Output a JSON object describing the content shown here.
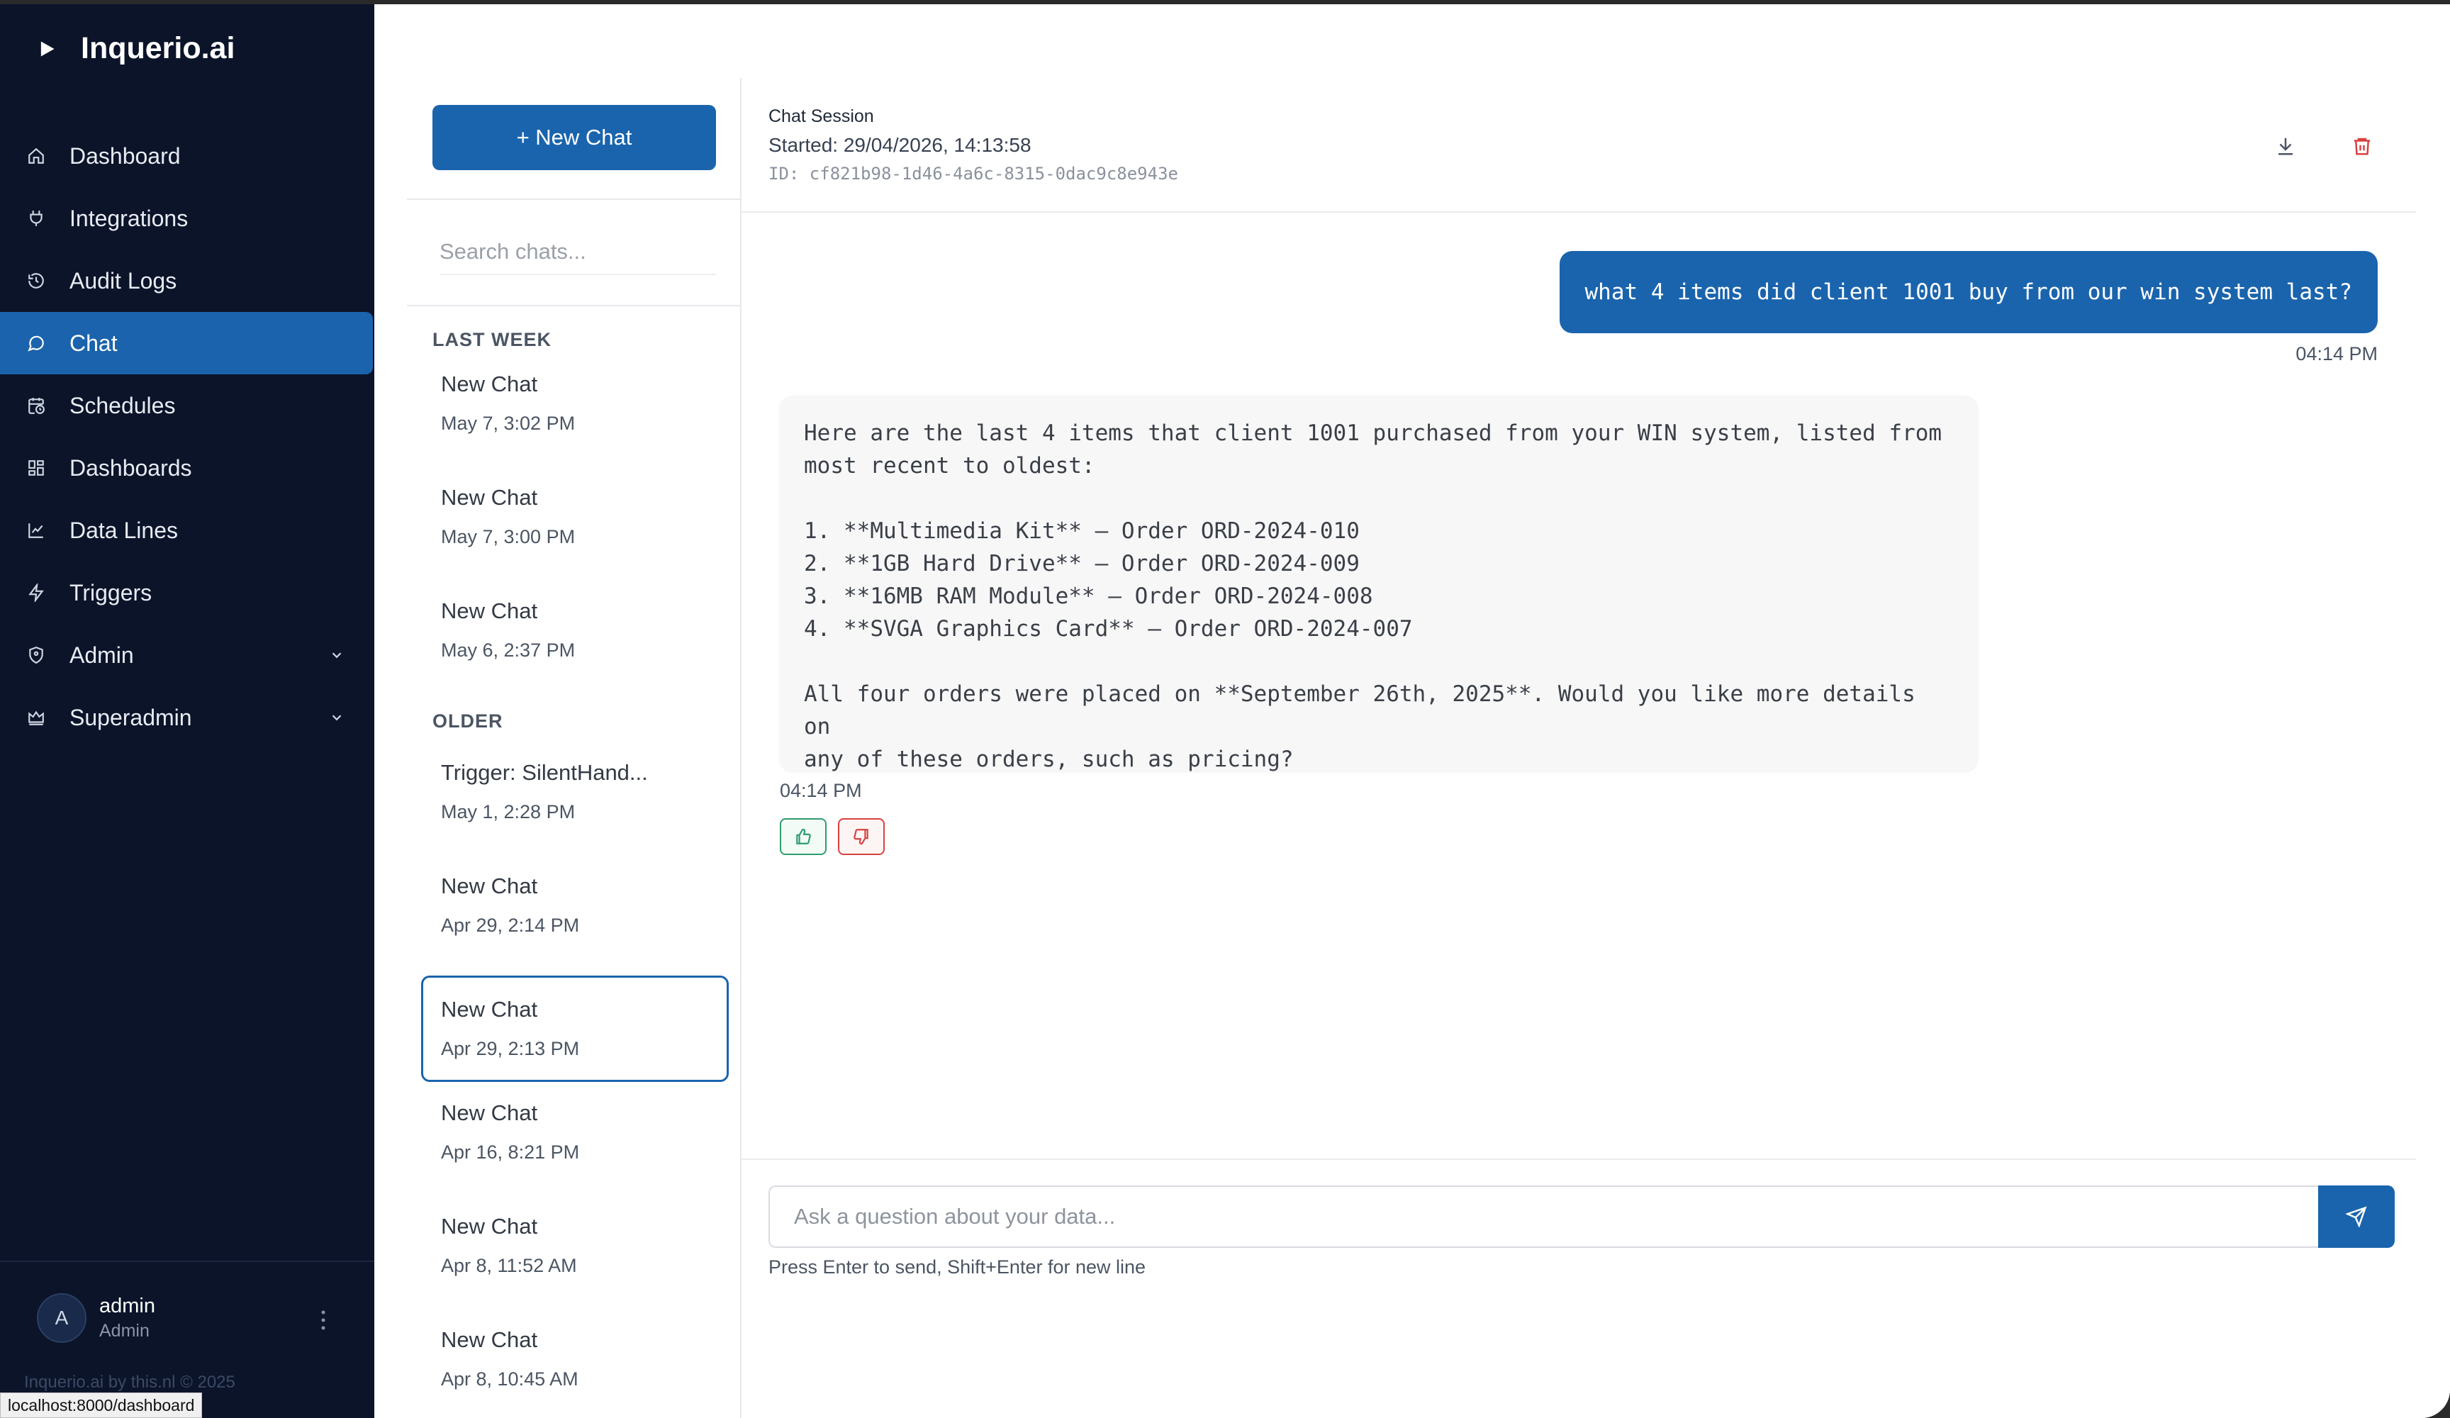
{
  "app": {
    "name": "Inquerio.ai",
    "footer": "Inquerio.ai by this.nl © 2025",
    "status_url": "localhost:8000/dashboard"
  },
  "sidebar": {
    "items": [
      {
        "label": "Dashboard",
        "icon": "home-icon"
      },
      {
        "label": "Integrations",
        "icon": "plug-icon"
      },
      {
        "label": "Audit Logs",
        "icon": "history-icon"
      },
      {
        "label": "Chat",
        "icon": "chat-bubble-icon",
        "active": true
      },
      {
        "label": "Schedules",
        "icon": "calendar-clock-icon"
      },
      {
        "label": "Dashboards",
        "icon": "grid-icon"
      },
      {
        "label": "Data Lines",
        "icon": "line-chart-icon"
      },
      {
        "label": "Triggers",
        "icon": "lightning-icon"
      },
      {
        "label": "Admin",
        "icon": "shield-icon",
        "expandable": true
      },
      {
        "label": "Superadmin",
        "icon": "crown-icon",
        "expandable": true
      }
    ],
    "user": {
      "initial": "A",
      "name": "admin",
      "role": "Admin"
    }
  },
  "chatlist": {
    "new_chat_label": "+ New Chat",
    "search_placeholder": "Search chats...",
    "groups": [
      {
        "label": "LAST WEEK",
        "chats": [
          {
            "title": "New Chat",
            "date": "May 7, 3:02 PM"
          },
          {
            "title": "New Chat",
            "date": "May 7, 3:00 PM"
          },
          {
            "title": "New Chat",
            "date": "May 6, 2:37 PM"
          }
        ]
      },
      {
        "label": "OLDER",
        "chats": [
          {
            "title": "Trigger: SilentHand...",
            "date": "May 1, 2:28 PM"
          },
          {
            "title": "New Chat",
            "date": "Apr 29, 2:14 PM"
          },
          {
            "title": "New Chat",
            "date": "Apr 29, 2:13 PM",
            "selected": true
          },
          {
            "title": "New Chat",
            "date": "Apr 16, 8:21 PM"
          },
          {
            "title": "New Chat",
            "date": "Apr 8, 11:52 AM"
          },
          {
            "title": "New Chat",
            "date": "Apr 8, 10:45 AM"
          }
        ]
      }
    ]
  },
  "session": {
    "label": "Chat Session",
    "started": "Started: 29/04/2026, 14:13:58",
    "id": "ID: cf821b98-1d46-4a6c-8315-0dac9c8e943e"
  },
  "messages": {
    "user_text": "what 4 items did client 1001 buy from our win system last?",
    "user_time": "04:14 PM",
    "bot_text": "Here are the last 4 items that client 1001 purchased from your WIN system, listed from\nmost recent to oldest:\n\n1. **Multimedia Kit** – Order ORD-2024-010\n2. **1GB Hard Drive** – Order ORD-2024-009\n3. **16MB RAM Module** – Order ORD-2024-008\n4. **SVGA Graphics Card** – Order ORD-2024-007\n\nAll four orders were placed on **September 26th, 2025**. Would you like more details on\nany of these orders, such as pricing?",
    "bot_time": "04:14 PM"
  },
  "composer": {
    "placeholder": "Ask a question about your data...",
    "hint": "Press Enter to send, Shift+Enter for new line"
  },
  "colors": {
    "sidebar_bg": "#0b1429",
    "accent": "#1a64ad",
    "thumbs_up": "#2e9d6e",
    "thumbs_down": "#d94141",
    "delete": "#d94141"
  }
}
